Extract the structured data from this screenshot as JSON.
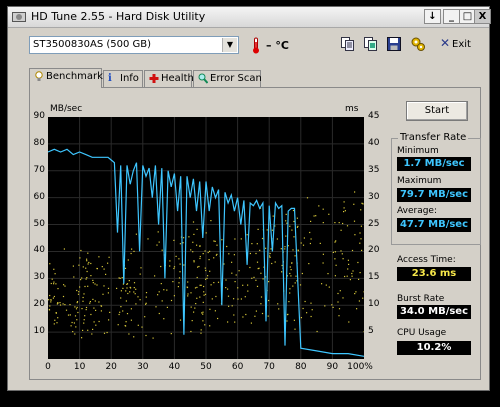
{
  "window": {
    "title": "HD Tune 2.55 - Hard Disk Utility",
    "buttons": {
      "help": "↓",
      "minimize": "_",
      "maximize": "□",
      "close": "X"
    }
  },
  "toolbar": {
    "drive": "ST3500830AS (500 GB)",
    "temperature": "– °C",
    "exit_label": "Exit",
    "icons": [
      "copy-info-icon",
      "copy-screenshot-icon",
      "save-icon",
      "options-icon"
    ]
  },
  "tabs": [
    {
      "label": "Benchmark",
      "icon": "lightbulb-icon"
    },
    {
      "label": "Info",
      "icon": "info-icon"
    },
    {
      "label": "Health",
      "icon": "health-cross-icon"
    },
    {
      "label": "Error Scan",
      "icon": "magnifier-icon"
    }
  ],
  "benchmark": {
    "start_label": "Start",
    "transfer_rate_title": "Transfer Rate",
    "minimum_label": "Minimum",
    "minimum_value": "1.7 MB/sec",
    "maximum_label": "Maximum",
    "maximum_value": "79.7 MB/sec",
    "average_label": "Average:",
    "average_value": "47.7 MB/sec",
    "access_label": "Access Time:",
    "access_value": "23.6 ms",
    "burst_label": "Burst Rate",
    "burst_value": "34.0 MB/sec",
    "cpu_label": "CPU Usage",
    "cpu_value": "10.2%"
  },
  "colors": {
    "transfer_line": "#3ec6ff",
    "access_dots": "#d8c83a",
    "grid": "#2a2a2a",
    "plot_bg": "#000000"
  },
  "chart_data": {
    "type": "line",
    "left_unit": "MB/sec",
    "right_unit": "ms",
    "y_ticks": [
      "90",
      "80",
      "70",
      "60",
      "50",
      "40",
      "30",
      "20",
      "10"
    ],
    "y2_ticks": [
      "45",
      "40",
      "35",
      "30",
      "25",
      "20",
      "15",
      "10",
      "5"
    ],
    "x_ticks": [
      "0",
      "10",
      "20",
      "30",
      "40",
      "50",
      "60",
      "70",
      "80",
      "90",
      "100%"
    ],
    "ylim": [
      0,
      90
    ],
    "y2lim": [
      0,
      45
    ],
    "xlim": [
      0,
      100
    ],
    "grid": true,
    "series": [
      {
        "x": [
          0,
          2,
          4,
          6,
          8,
          10,
          12,
          14,
          16,
          18,
          19,
          20,
          21,
          22,
          23,
          24,
          25,
          26,
          27,
          28,
          29,
          30,
          31,
          32,
          33,
          34,
          35,
          36,
          37,
          38,
          39,
          40,
          41,
          42,
          43,
          44,
          45,
          46,
          47,
          48,
          49,
          50,
          51,
          52,
          53,
          54,
          55,
          56,
          57,
          58,
          59,
          60,
          61,
          62,
          63,
          64,
          65,
          66,
          67,
          68,
          69,
          70,
          71,
          72,
          73,
          74,
          75,
          76,
          77,
          78,
          80,
          85,
          90,
          95,
          100
        ],
        "y": [
          77,
          78,
          77,
          78,
          76,
          77,
          76,
          75,
          75,
          75,
          75,
          74,
          73,
          47,
          72,
          28,
          72,
          65,
          70,
          73,
          40,
          72,
          68,
          71,
          60,
          72,
          50,
          71,
          30,
          70,
          64,
          69,
          55,
          68,
          9,
          68,
          60,
          67,
          55,
          66,
          45,
          66,
          55,
          64,
          60,
          63,
          20,
          62,
          58,
          61,
          55,
          60,
          50,
          59,
          35,
          58,
          57,
          59,
          56,
          58,
          14,
          57,
          40,
          58,
          56,
          57,
          5,
          55,
          56,
          56,
          4,
          3,
          2,
          2,
          1
        ]
      }
    ]
  }
}
